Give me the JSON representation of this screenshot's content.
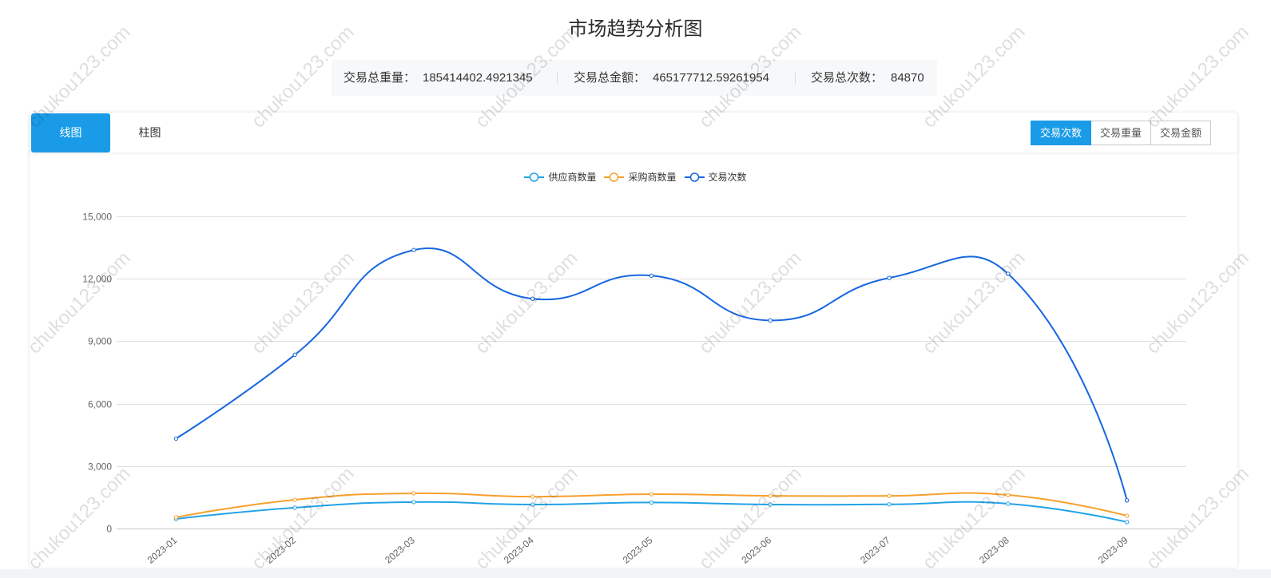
{
  "page": {
    "title": "市场趋势分析图"
  },
  "summary": [
    {
      "label": "交易总重量：",
      "value": "185414402.4921345"
    },
    {
      "label": "交易总金额：",
      "value": "465177712.59261954"
    },
    {
      "label": "交易总次数：",
      "value": "84870"
    }
  ],
  "chart_tabs": [
    {
      "label": "线图",
      "active": true
    },
    {
      "label": "柱图",
      "active": false
    }
  ],
  "metric_buttons": [
    {
      "label": "交易次数",
      "active": true
    },
    {
      "label": "交易重量",
      "active": false
    },
    {
      "label": "交易金额",
      "active": false
    }
  ],
  "colors": {
    "accent": "#1a9be8",
    "summary_bg": "#f7f8fa"
  },
  "watermark": {
    "text": "chukou123.com"
  },
  "chart_data": {
    "type": "line",
    "smooth": true,
    "categories": [
      "2023-01",
      "2023-02",
      "2023-03",
      "2023-04",
      "2023-05",
      "2023-06",
      "2023-07",
      "2023-08",
      "2023-09"
    ],
    "series": [
      {
        "name": "供应商数量",
        "color": "#22a3e6",
        "values": [
          460,
          1000,
          1270,
          1150,
          1250,
          1150,
          1160,
          1190,
          310
        ]
      },
      {
        "name": "采购商数量",
        "color": "#f7a02c",
        "values": [
          540,
          1380,
          1690,
          1530,
          1650,
          1570,
          1570,
          1610,
          610
        ]
      },
      {
        "name": "交易次数",
        "color": "#1767e0",
        "values": [
          4320,
          8350,
          13380,
          11040,
          12150,
          10000,
          12040,
          12240,
          1350
        ]
      }
    ],
    "ylim": [
      0,
      15000
    ],
    "yticks": [
      0,
      3000,
      6000,
      9000,
      12000,
      15000
    ],
    "ytick_labels": [
      "0",
      "3,000",
      "6,000",
      "9,000",
      "12,000",
      "15,000"
    ],
    "grid": true,
    "legend_position": "top-center"
  }
}
